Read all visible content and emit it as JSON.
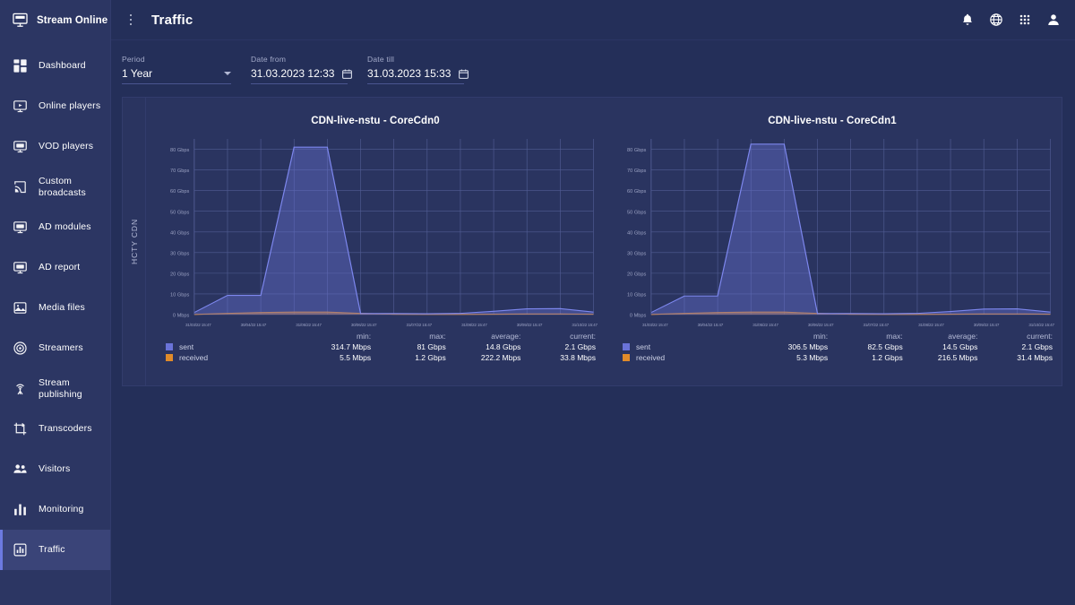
{
  "brand": {
    "name": "Stream Online",
    "logo_icon": "monitor-live-icon"
  },
  "sidebar": {
    "items": [
      {
        "label": "Dashboard",
        "icon": "dashboard-grid-icon",
        "active": false
      },
      {
        "label": "Online players",
        "icon": "player-screen-icon",
        "active": false
      },
      {
        "label": "VOD players",
        "icon": "vod-screen-icon",
        "active": false
      },
      {
        "label": "Custom broadcasts",
        "icon": "cast-icon",
        "active": false
      },
      {
        "label": "AD modules",
        "icon": "ad-screen-icon",
        "active": false
      },
      {
        "label": "AD report",
        "icon": "ad-report-icon",
        "active": false
      },
      {
        "label": "Media files",
        "icon": "media-image-icon",
        "active": false
      },
      {
        "label": "Streamers",
        "icon": "broadcast-signal-icon",
        "active": false
      },
      {
        "label": "Stream publishing",
        "icon": "antenna-icon",
        "active": false
      },
      {
        "label": "Transcoders",
        "icon": "crop-transcode-icon",
        "active": false
      },
      {
        "label": "Visitors",
        "icon": "people-icon",
        "active": false
      },
      {
        "label": "Monitoring",
        "icon": "bar-chart-icon",
        "active": false
      },
      {
        "label": "Traffic",
        "icon": "traffic-chart-icon",
        "active": true
      }
    ]
  },
  "topbar": {
    "menu_icon": "kebab-menu-icon",
    "title": "Traffic",
    "icons": [
      {
        "name": "bell-icon"
      },
      {
        "name": "globe-icon"
      },
      {
        "name": "apps-grid-icon"
      },
      {
        "name": "user-account-icon"
      }
    ]
  },
  "filters": {
    "period": {
      "label": "Period",
      "value": "1 Year",
      "caret_icon": "chevron-down-icon"
    },
    "date_from": {
      "label": "Date from",
      "value": "31.03.2023 12:33",
      "icon": "calendar-icon"
    },
    "date_till": {
      "label": "Date till",
      "value": "31.03.2023 15:33",
      "icon": "calendar-icon"
    }
  },
  "panel": {
    "side_label": "HCTY CDN"
  },
  "stats_headers": {
    "min": "min:",
    "max": "max:",
    "average": "average:",
    "current": "current:"
  },
  "colors": {
    "sent": "#6a73d8",
    "received": "#e08b2a",
    "sidebar_bg": "#2c3663",
    "content_bg": "#242f59",
    "panel_bg": "#2a3460",
    "accent": "#6c7ae0"
  },
  "chart_data": [
    {
      "type": "area",
      "title": "CDN-live-nstu - CoreCdn0",
      "xlabel": "",
      "ylabel": "",
      "ylim": [
        0,
        85
      ],
      "grid": true,
      "legend_position": "bottom",
      "yticks": [
        "0 Mbps",
        "10 Gbps",
        "20 Gbps",
        "30 Gbps",
        "40 Gbps",
        "50 Gbps",
        "60 Gbps",
        "70 Gbps",
        "80 Gbps"
      ],
      "x": [
        "31/03/22 15:47",
        "30/04/22 15:47",
        "31/05/22 15:47",
        "30/06/22 15:47",
        "31/07/22 15:47",
        "31/08/22 15:47",
        "30/09/22 15:47",
        "31/10/22 15:47"
      ],
      "xticks": [
        "31/03/22 15:47",
        "30/04/22 15:47",
        "31/05/22 15:47",
        "30/06/22 15:47",
        "31/07/22 15:47",
        "31/08/22 15:47",
        "30/09/22 15:47",
        "31/10/22 15:47"
      ],
      "series": [
        {
          "name": "sent",
          "color": "#6a73d8",
          "values": [
            1.0,
            9.3,
            9.3,
            81.0,
            81.0,
            0.5,
            0.5,
            0.4,
            0.6,
            1.6,
            2.8,
            2.9,
            1.2
          ]
        },
        {
          "name": "received",
          "color": "#e08b2a",
          "values": [
            0.1,
            0.6,
            1.0,
            1.2,
            1.2,
            0.6,
            0.2,
            0.15,
            0.15,
            0.2,
            0.3,
            0.3,
            0.2
          ]
        }
      ],
      "stats": {
        "rows": [
          {
            "label": "sent",
            "color": "#6a73d8",
            "min": "314.7 Mbps",
            "max": "81 Gbps",
            "average": "14.8 Gbps",
            "current": "2.1 Gbps"
          },
          {
            "label": "received",
            "color": "#e08b2a",
            "min": "5.5 Mbps",
            "max": "1.2 Gbps",
            "average": "222.2 Mbps",
            "current": "33.8 Mbps"
          }
        ]
      }
    },
    {
      "type": "area",
      "title": "CDN-live-nstu - CoreCdn1",
      "xlabel": "",
      "ylabel": "",
      "ylim": [
        0,
        85
      ],
      "grid": true,
      "legend_position": "bottom",
      "yticks": [
        "0 Mbps",
        "10 Gbps",
        "20 Gbps",
        "30 Gbps",
        "40 Gbps",
        "50 Gbps",
        "60 Gbps",
        "70 Gbps",
        "80 Gbps"
      ],
      "x": [
        "31/03/22 15:47",
        "30/04/22 15:47",
        "31/05/22 15:47",
        "30/06/22 15:47",
        "31/07/22 15:47",
        "31/08/22 15:47",
        "30/09/22 15:47",
        "31/10/22 15:47"
      ],
      "xticks": [
        "31/03/22 15:47",
        "30/04/22 15:47",
        "31/05/22 15:47",
        "30/06/22 15:47",
        "31/07/22 15:47",
        "31/08/22 15:47",
        "30/09/22 15:47",
        "31/10/22 15:47"
      ],
      "series": [
        {
          "name": "sent",
          "color": "#6a73d8",
          "values": [
            1.0,
            9.0,
            9.0,
            82.5,
            82.5,
            0.5,
            0.5,
            0.4,
            0.6,
            1.5,
            2.7,
            2.8,
            1.2
          ]
        },
        {
          "name": "received",
          "color": "#e08b2a",
          "values": [
            0.1,
            0.6,
            1.0,
            1.2,
            1.2,
            0.6,
            0.2,
            0.15,
            0.15,
            0.2,
            0.3,
            0.3,
            0.2
          ]
        }
      ],
      "stats": {
        "rows": [
          {
            "label": "sent",
            "color": "#6a73d8",
            "min": "306.5 Mbps",
            "max": "82.5 Gbps",
            "average": "14.5 Gbps",
            "current": "2.1 Gbps"
          },
          {
            "label": "received",
            "color": "#e08b2a",
            "min": "5.3 Mbps",
            "max": "1.2 Gbps",
            "average": "216.5 Mbps",
            "current": "31.4 Mbps"
          }
        ]
      }
    }
  ]
}
